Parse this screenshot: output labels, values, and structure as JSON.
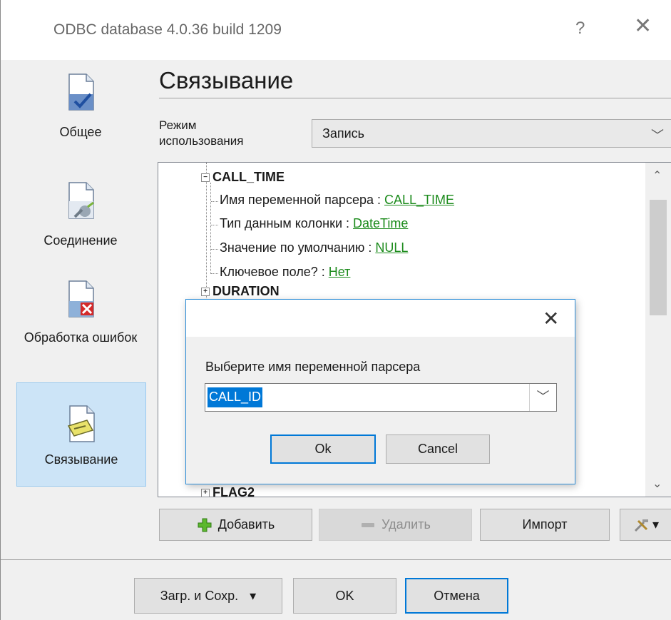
{
  "window": {
    "title": "ODBC database 4.0.36 build 1209",
    "help_glyph": "?",
    "close_glyph": "✕"
  },
  "sidebar": {
    "items": [
      {
        "label": "Общее",
        "icon": "document-check-icon",
        "active": false
      },
      {
        "label": "Соединение",
        "icon": "document-plug-icon",
        "active": false
      },
      {
        "label": "Обработка ошибок",
        "icon": "document-error-icon",
        "active": false
      },
      {
        "label": "Связывание",
        "icon": "document-link-icon",
        "active": true
      }
    ]
  },
  "main": {
    "title": "Связывание",
    "mode": {
      "label_line1": "Режим",
      "label_line2": "использования",
      "value": "Запись",
      "chevron": "﹀"
    },
    "tree": {
      "nodes": [
        {
          "name": "CALL_TIME",
          "expanded": true,
          "expander": "−"
        },
        {
          "name": "DURATION",
          "expanded": false,
          "expander": "+"
        },
        {
          "name": "FLAG2",
          "expanded": false,
          "expander": "+"
        }
      ],
      "call_time_props": [
        {
          "label": "Имя переменной парсера : ",
          "value": "CALL_TIME"
        },
        {
          "label": "Тип данным колонки : ",
          "value": "DateTime"
        },
        {
          "label": "Значение по умолчанию : ",
          "value": "NULL"
        },
        {
          "label": "Ключевое поле? : ",
          "value": "Нет"
        }
      ],
      "scroll_up": "⌃",
      "scroll_down": "⌄"
    },
    "toolbar": {
      "add_label": "Добавить",
      "delete_label": "Удалить",
      "import_label": "Импорт",
      "tools_arrow": "▾"
    }
  },
  "footer": {
    "load_save_label": "Загр. и Сохр.",
    "load_save_arrow": "▾",
    "ok_label": "OK",
    "cancel_label": "Отмена"
  },
  "dialog": {
    "close_glyph": "✕",
    "prompt": "Выберите имя переменной парсера",
    "combo_value": "CALL_ID",
    "combo_chevron": "﹀",
    "ok_label": "Ok",
    "cancel_label": "Cancel"
  },
  "colors": {
    "accent": "#0078d7",
    "link_green": "#1c8b1c",
    "sidebar_active": "#cce4f7"
  }
}
